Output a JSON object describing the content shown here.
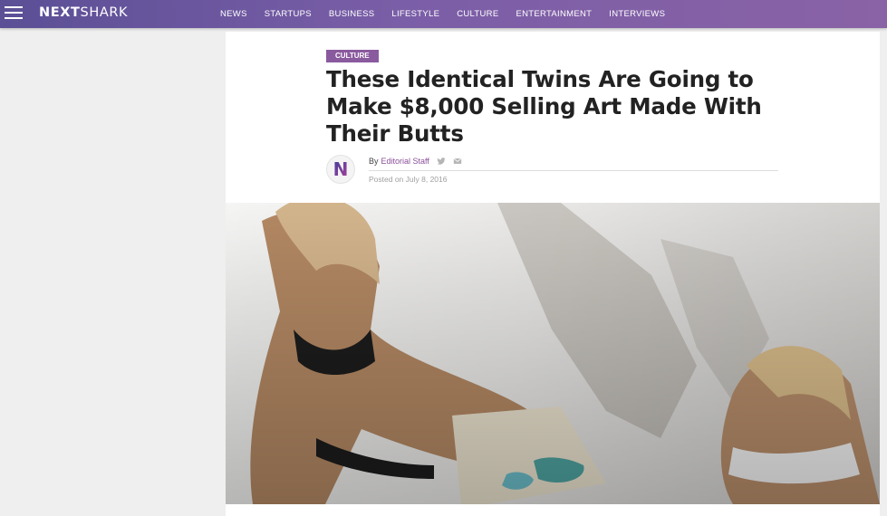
{
  "header": {
    "logo_bold": "NEXT",
    "logo_rest": "SHARK",
    "nav": [
      "NEWS",
      "STARTUPS",
      "BUSINESS",
      "LIFESTYLE",
      "CULTURE",
      "ENTERTAINMENT",
      "INTERVIEWS"
    ]
  },
  "article": {
    "category": "CULTURE",
    "title": "These Identical Twins Are Going to Make $8,000 Selling Art Made With Their Butts",
    "avatar_letter": "N",
    "by_prefix": "By",
    "author": "Editorial Staff",
    "posted": "Posted on July 8, 2016"
  },
  "colors": {
    "header_gradient_start": "#5b4f96",
    "header_gradient_end": "#8a62a6",
    "category_tag": "#8a5a9e",
    "author_link": "#8a4f9a"
  },
  "icons": [
    "menu-icon",
    "twitter-icon",
    "email-icon"
  ]
}
